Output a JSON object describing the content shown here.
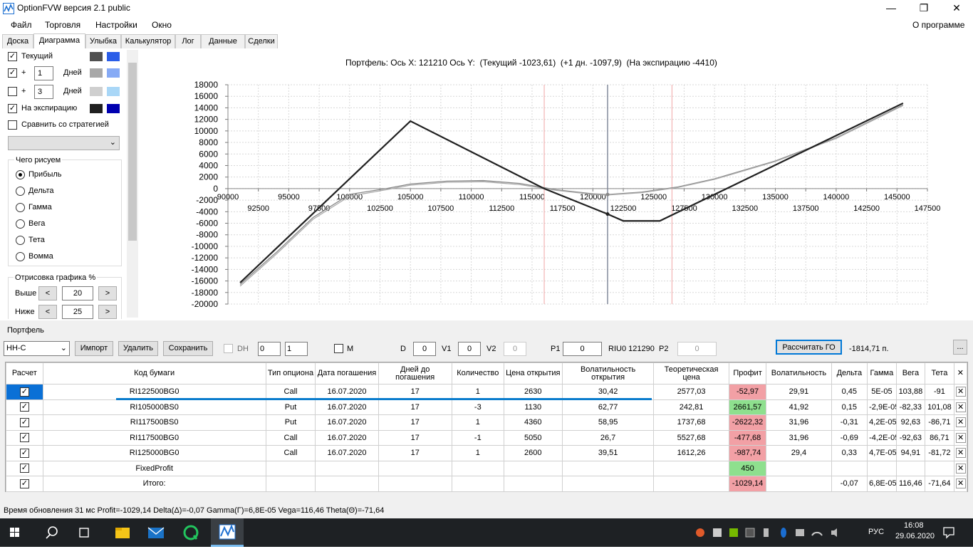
{
  "window": {
    "title": "OptionFVW версия 2.1 public",
    "min": "—",
    "max": "❐",
    "close": "✕"
  },
  "menu": {
    "items": [
      "Файл",
      "Торговля",
      "Настройки",
      "Окно"
    ],
    "about": "О программе"
  },
  "tabs": [
    "Доска",
    "Диаграмма",
    "Улыбка",
    "Калькулятор",
    "Лог",
    "Данные",
    "Сделки"
  ],
  "left": {
    "current": "Текущий",
    "plus1": "+",
    "days1": "1",
    "days_lbl": "Дней",
    "plus2": "+",
    "days2": "3",
    "days_lbl2": "Дней",
    "expiry": "На экспирацию",
    "compare": "Сравнить со стратегией",
    "what_draw": "Чего рисуем",
    "radios": [
      "Прибыль",
      "Дельта",
      "Гамма",
      "Вега",
      "Тета",
      "Вомма"
    ],
    "draw_pct": "Отрисовка графика %",
    "above": "Выше",
    "above_val": "20",
    "below": "Ниже",
    "below_val": "25",
    "colors": {
      "cur1": "#505050",
      "cur2": "#2a5de8",
      "d1a": "#a8a8a8",
      "d1b": "#86aaf5",
      "d3a": "#cfcfcf",
      "d3b": "#a9d7f7",
      "exp1": "#202020",
      "exp2": "#0000b0"
    }
  },
  "chart_header": "Портфель: Ось X: 121210 Ось Y:  (Текущий -1023,61)  (+1 дн. -1097,9)  (На экспирацию -4410)",
  "chart_data": {
    "type": "line",
    "xlim": [
      90000,
      147500
    ],
    "ylim": [
      -20000,
      18000
    ],
    "x_ticks_top": [
      "90000",
      "95000",
      "100000",
      "105000",
      "110000",
      "115000",
      "120000",
      "125000",
      "130000",
      "135000",
      "140000",
      "145000"
    ],
    "x_ticks_bottom": [
      "92500",
      "97500",
      "102500",
      "107500",
      "112500",
      "117500",
      "122500",
      "127500",
      "132500",
      "137500",
      "142500",
      "147500"
    ],
    "y_ticks": [
      "18000",
      "16000",
      "14000",
      "12000",
      "10000",
      "8000",
      "6000",
      "4000",
      "2000",
      "0",
      "-2000",
      "-4000",
      "-6000",
      "-8000",
      "-10000",
      "-12000",
      "-14000",
      "-16000",
      "-18000",
      "-20000"
    ],
    "series": [
      {
        "style": "expiry",
        "color": "#202020",
        "x": [
          91000,
          105000,
          116000,
          121210,
          122500,
          125500,
          145500
        ],
        "y": [
          -16300,
          11700,
          0,
          -4410,
          -5600,
          -5600,
          14800
        ]
      },
      {
        "style": "current",
        "color": "#888888",
        "x": [
          91000,
          94000,
          97000,
          100000,
          103000,
          105000,
          108000,
          111000,
          114000,
          117000,
          120000,
          121210,
          124000,
          127000,
          130000,
          135000,
          140000,
          145500
        ],
        "y": [
          -16600,
          -11000,
          -5000,
          -1000,
          0,
          800,
          1300,
          1400,
          900,
          -200,
          -900,
          -1024,
          -600,
          300,
          1700,
          4800,
          8800,
          14500
        ]
      },
      {
        "style": "plus1",
        "color": "#aaaaaa",
        "x": [
          91000,
          94000,
          97000,
          100000,
          103000,
          105000,
          108000,
          111000,
          114000,
          117000,
          120000,
          121210,
          124000,
          127000,
          130000,
          135000,
          140000,
          145500
        ],
        "y": [
          -16900,
          -11300,
          -5300,
          -1300,
          -200,
          600,
          1100,
          1200,
          700,
          -300,
          -1000,
          -1098,
          -700,
          200,
          1600,
          4700,
          8700,
          14400
        ]
      }
    ],
    "vlines_red": [
      116000,
      126500
    ],
    "vline_cursor": 121210
  },
  "portfolio": {
    "label": "Портфель",
    "select": "НН-С",
    "import": "Импорт",
    "delete": "Удалить",
    "save": "Сохранить",
    "dh": "DH",
    "dh_v1": "0",
    "dh_v2": "1",
    "m": "M",
    "d": "D",
    "d_val": "0",
    "v1": "V1",
    "v1_val": "0",
    "v2": "V2",
    "v2_val": "0",
    "p1": "P1",
    "p1_val": "0",
    "riu": "RIU0 121290",
    "p2": "P2",
    "p2_val": "0",
    "calc": "Рассчитать ГО",
    "go": "-1814,71 п.",
    "dots": "..."
  },
  "table": {
    "headers": [
      "Расчет",
      "Код бумаги",
      "Тип опциона",
      "Дата погашения",
      "Дней до погашения",
      "Количество",
      "Цена открытия",
      "Волатильность открытия",
      "Теоретическая цена",
      "Профит",
      "Волатильность",
      "Дельта",
      "Гамма",
      "Вега",
      "Тета",
      "✕"
    ],
    "rows": [
      [
        "✓",
        "RI122500BG0",
        "Call",
        "16.07.2020",
        "17",
        "1",
        "2630",
        "30,42",
        "2577,03",
        "-52,97",
        "29,91",
        "0,45",
        "5E-05",
        "103,88",
        "-91",
        "✕"
      ],
      [
        "✓",
        "RI105000BS0",
        "Put",
        "16.07.2020",
        "17",
        "-3",
        "1130",
        "62,77",
        "242,81",
        "2661,57",
        "41,92",
        "0,15",
        "-2,9E-05",
        "-82,33",
        "101,08",
        "✕"
      ],
      [
        "✓",
        "RI117500BS0",
        "Put",
        "16.07.2020",
        "17",
        "1",
        "4360",
        "58,95",
        "1737,68",
        "-2622,32",
        "31,96",
        "-0,31",
        "4,2E-05",
        "92,63",
        "-86,71",
        "✕"
      ],
      [
        "✓",
        "RI117500BG0",
        "Call",
        "16.07.2020",
        "17",
        "-1",
        "5050",
        "26,7",
        "5527,68",
        "-477,68",
        "31,96",
        "-0,69",
        "-4,2E-05",
        "-92,63",
        "86,71",
        "✕"
      ],
      [
        "✓",
        "RI125000BG0",
        "Call",
        "16.07.2020",
        "17",
        "1",
        "2600",
        "39,51",
        "1612,26",
        "-987,74",
        "29,4",
        "0,33",
        "4,7E-05",
        "94,91",
        "-81,72",
        "✕"
      ],
      [
        "✓",
        "FixedProfit",
        "",
        "",
        "",
        "",
        "",
        "",
        "",
        "450",
        "",
        "",
        "",
        "",
        "",
        "✕"
      ],
      [
        "✓",
        "Итого:",
        "",
        "",
        "",
        "",
        "",
        "",
        "",
        "-1029,14",
        "",
        "-0,07",
        "6,8E-05",
        "116,46",
        "-71,64",
        "✕"
      ]
    ],
    "profit_class": [
      "neg",
      "pos",
      "neg",
      "neg",
      "neg",
      "pos",
      "neg"
    ]
  },
  "status": "Время обновления 31 мс  Profit=-1029,14 Delta(Δ)=-0,07 Gamma(Γ)=6,8E-05 Vega=116,46 Theta(Θ)=-71,64",
  "taskbar": {
    "lang": "РУС",
    "time": "16:08",
    "date": "29.06.2020"
  }
}
